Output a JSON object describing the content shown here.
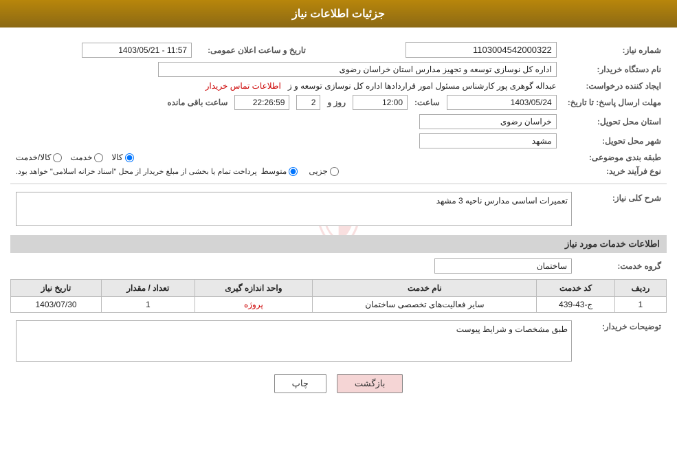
{
  "header": {
    "title": "جزئیات اطلاعات نیاز"
  },
  "fields": {
    "order_number_label": "شماره نیاز:",
    "order_number_value": "1103004542000322",
    "date_label": "تاریخ و ساعت اعلان عمومی:",
    "date_value": "1403/05/21 - 11:57",
    "buyer_label": "نام دستگاه خریدار:",
    "buyer_value": "اداره کل نوسازی  توسعه و تجهیز مدارس استان خراسان رضوی",
    "creator_label": "ایجاد کننده درخواست:",
    "creator_value": "عبداله گوهری پور کارشناس مسئول امور قراردادها  اداره کل نوسازی  توسعه و ز",
    "contact_link": "اطلاعات تماس خریدار",
    "deadline_label": "مهلت ارسال پاسخ: تا تاریخ:",
    "deadline_date": "1403/05/24",
    "deadline_time_label": "ساعت:",
    "deadline_time": "12:00",
    "deadline_days_label": "روز و",
    "deadline_days": "2",
    "remaining_label": "ساعت باقی مانده",
    "remaining_time": "22:26:59",
    "province_label": "استان محل تحویل:",
    "province_value": "خراسان رضوی",
    "city_label": "شهر محل تحویل:",
    "city_value": "مشهد",
    "category_label": "طبقه بندی موضوعی:",
    "category_options": [
      "کالا",
      "خدمت",
      "کالا/خدمت"
    ],
    "category_selected": "کالا",
    "process_label": "نوع فرآیند خرید:",
    "process_options": [
      "جزیی",
      "متوسط"
    ],
    "process_selected": "متوسط",
    "process_note": "پرداخت تمام یا بخشی از مبلغ خریدار از محل \"اسناد خزانه اسلامی\" خواهد بود.",
    "description_label": "شرح کلی نیاز:",
    "description_value": "تعمیرات اساسی مدارس ناحیه 3 مشهد",
    "services_section_title": "اطلاعات خدمات مورد نیاز",
    "service_group_label": "گروه خدمت:",
    "service_group_value": "ساختمان",
    "services_table": {
      "columns": [
        "ردیف",
        "کد خدمت",
        "نام خدمت",
        "واحد اندازه گیری",
        "تعداد / مقدار",
        "تاریخ نیاز"
      ],
      "rows": [
        {
          "row": "1",
          "code": "ج-43-439",
          "name": "سایر فعالیت‌های تخصصی ساختمان",
          "unit": "پروژه",
          "quantity": "1",
          "date": "1403/07/30"
        }
      ]
    },
    "buyer_desc_label": "توضیحات خریدار:",
    "buyer_desc_value": "طبق مشخصات و شرایط پیوست"
  },
  "buttons": {
    "print": "چاپ",
    "back": "بازگشت"
  }
}
